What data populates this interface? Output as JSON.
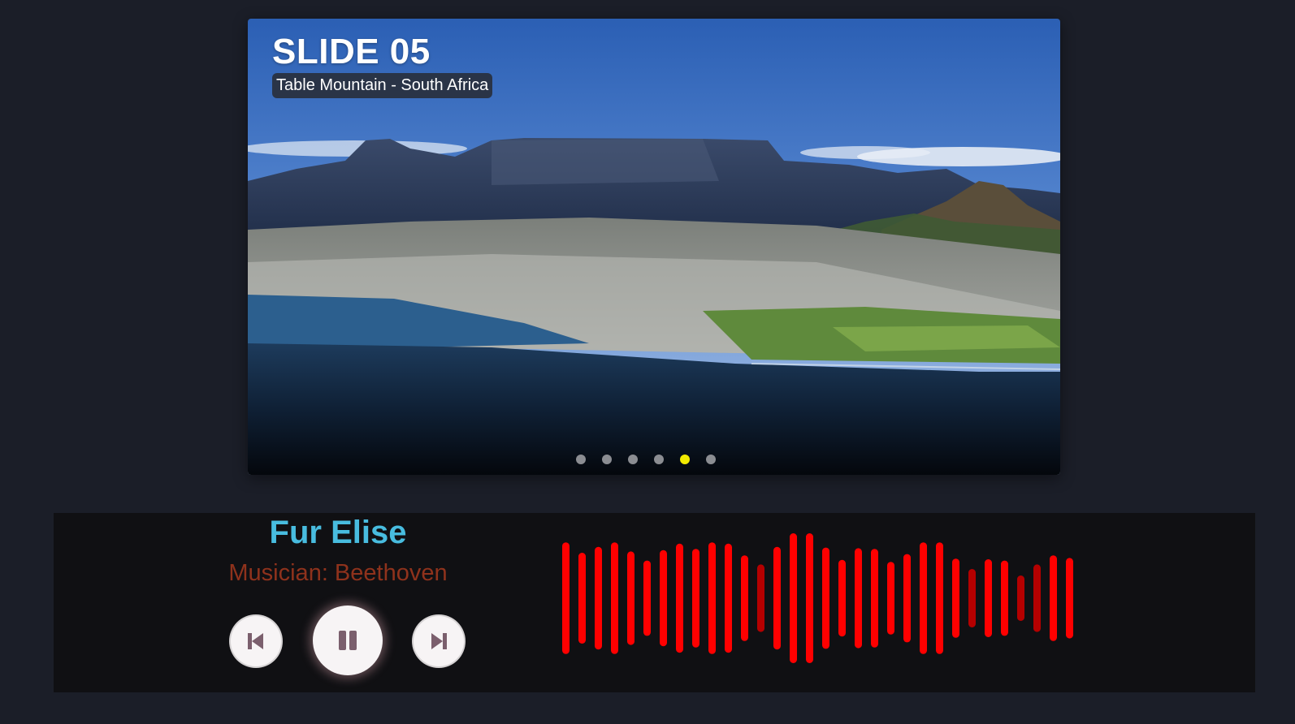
{
  "slider": {
    "title": "SLIDE 05",
    "caption": "Table Mountain - South Africa",
    "total_slides": 6,
    "active_index": 4
  },
  "player": {
    "song_title": "Fur Elise",
    "artist_label": "Musician: Beethoven",
    "controls": [
      "previous-track",
      "pause",
      "next-track"
    ],
    "is_playing": true,
    "visualizer_levels": [
      0.86,
      0.7,
      0.79,
      0.86,
      0.72,
      0.58,
      0.74,
      0.84,
      0.76,
      0.86,
      0.84,
      0.66,
      0.52,
      0.79,
      1.0,
      1.0,
      0.78,
      0.59,
      0.77,
      0.76,
      0.56,
      0.68,
      0.86,
      0.86,
      0.61,
      0.45,
      0.6,
      0.58,
      0.35,
      0.52,
      0.66,
      0.62
    ],
    "visualizer_dim_bars": [
      12,
      25,
      28,
      29
    ]
  },
  "colors": {
    "background": "#1b1e28",
    "player_bg": "#101013",
    "title": "#48bcdf",
    "artist": "#8f321c",
    "bar": "#ff0000",
    "bar_dim": "#b50000",
    "dot": "#8b8d92",
    "dot_active": "#f2ea00"
  }
}
